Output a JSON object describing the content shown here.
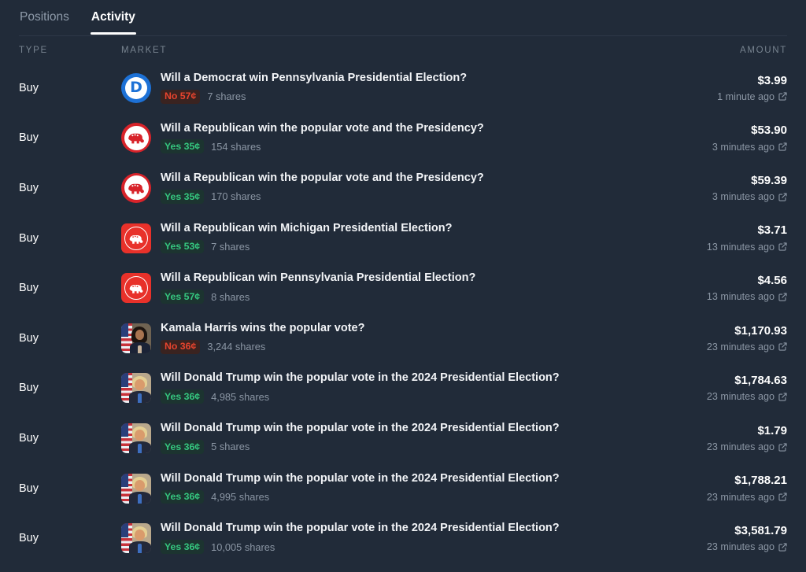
{
  "tabs": [
    {
      "label": "Positions",
      "active": false
    },
    {
      "label": "Activity",
      "active": true
    }
  ],
  "columns": {
    "type": "TYPE",
    "market": "MARKET",
    "amount": "AMOUNT"
  },
  "colors": {
    "background": "#212b39",
    "yes_text": "#35c77f",
    "yes_bg": "#1c3430",
    "no_text": "#e8442e",
    "no_bg": "#3a2320",
    "democrat_blue": "#1d71d6",
    "republican_red": "#d8232a",
    "republican_tile_red": "#e8312a",
    "active_tab": "#ffffff",
    "muted_text": "#8b96a4"
  },
  "icons": {
    "external_link": "external-link-icon"
  },
  "rows": [
    {
      "type": "Buy",
      "avatar": "democrat-logo",
      "title": "Will a Democrat win Pennsylvania Presidential Election?",
      "outcome": "No 57¢",
      "outcome_side": "no",
      "shares": "7 shares",
      "amount": "$3.99",
      "time": "1 minute ago"
    },
    {
      "type": "Buy",
      "avatar": "republican-logo-circle",
      "title": "Will a Republican win the popular vote and the Presidency?",
      "outcome": "Yes 35¢",
      "outcome_side": "yes",
      "shares": "154 shares",
      "amount": "$53.90",
      "time": "3 minutes ago"
    },
    {
      "type": "Buy",
      "avatar": "republican-logo-circle",
      "title": "Will a Republican win the popular vote and the Presidency?",
      "outcome": "Yes 35¢",
      "outcome_side": "yes",
      "shares": "170 shares",
      "amount": "$59.39",
      "time": "3 minutes ago"
    },
    {
      "type": "Buy",
      "avatar": "republican-logo-square",
      "title": "Will a Republican win Michigan Presidential Election?",
      "outcome": "Yes 53¢",
      "outcome_side": "yes",
      "shares": "7 shares",
      "amount": "$3.71",
      "time": "13 minutes ago"
    },
    {
      "type": "Buy",
      "avatar": "republican-logo-square",
      "title": "Will a Republican win Pennsylvania Presidential Election?",
      "outcome": "Yes 57¢",
      "outcome_side": "yes",
      "shares": "8 shares",
      "amount": "$4.56",
      "time": "13 minutes ago"
    },
    {
      "type": "Buy",
      "avatar": "kamala-harris-portrait",
      "title": "Kamala Harris wins the popular vote?",
      "outcome": "No 36¢",
      "outcome_side": "no",
      "shares": "3,244 shares",
      "amount": "$1,170.93",
      "time": "23 minutes ago"
    },
    {
      "type": "Buy",
      "avatar": "donald-trump-portrait",
      "title": "Will Donald Trump win the popular vote in the 2024 Presidential Election?",
      "outcome": "Yes 36¢",
      "outcome_side": "yes",
      "shares": "4,985 shares",
      "amount": "$1,784.63",
      "time": "23 minutes ago"
    },
    {
      "type": "Buy",
      "avatar": "donald-trump-portrait",
      "title": "Will Donald Trump win the popular vote in the 2024 Presidential Election?",
      "outcome": "Yes 36¢",
      "outcome_side": "yes",
      "shares": "5 shares",
      "amount": "$1.79",
      "time": "23 minutes ago"
    },
    {
      "type": "Buy",
      "avatar": "donald-trump-portrait",
      "title": "Will Donald Trump win the popular vote in the 2024 Presidential Election?",
      "outcome": "Yes 36¢",
      "outcome_side": "yes",
      "shares": "4,995 shares",
      "amount": "$1,788.21",
      "time": "23 minutes ago"
    },
    {
      "type": "Buy",
      "avatar": "donald-trump-portrait",
      "title": "Will Donald Trump win the popular vote in the 2024 Presidential Election?",
      "outcome": "Yes 36¢",
      "outcome_side": "yes",
      "shares": "10,005 shares",
      "amount": "$3,581.79",
      "time": "23 minutes ago"
    }
  ]
}
